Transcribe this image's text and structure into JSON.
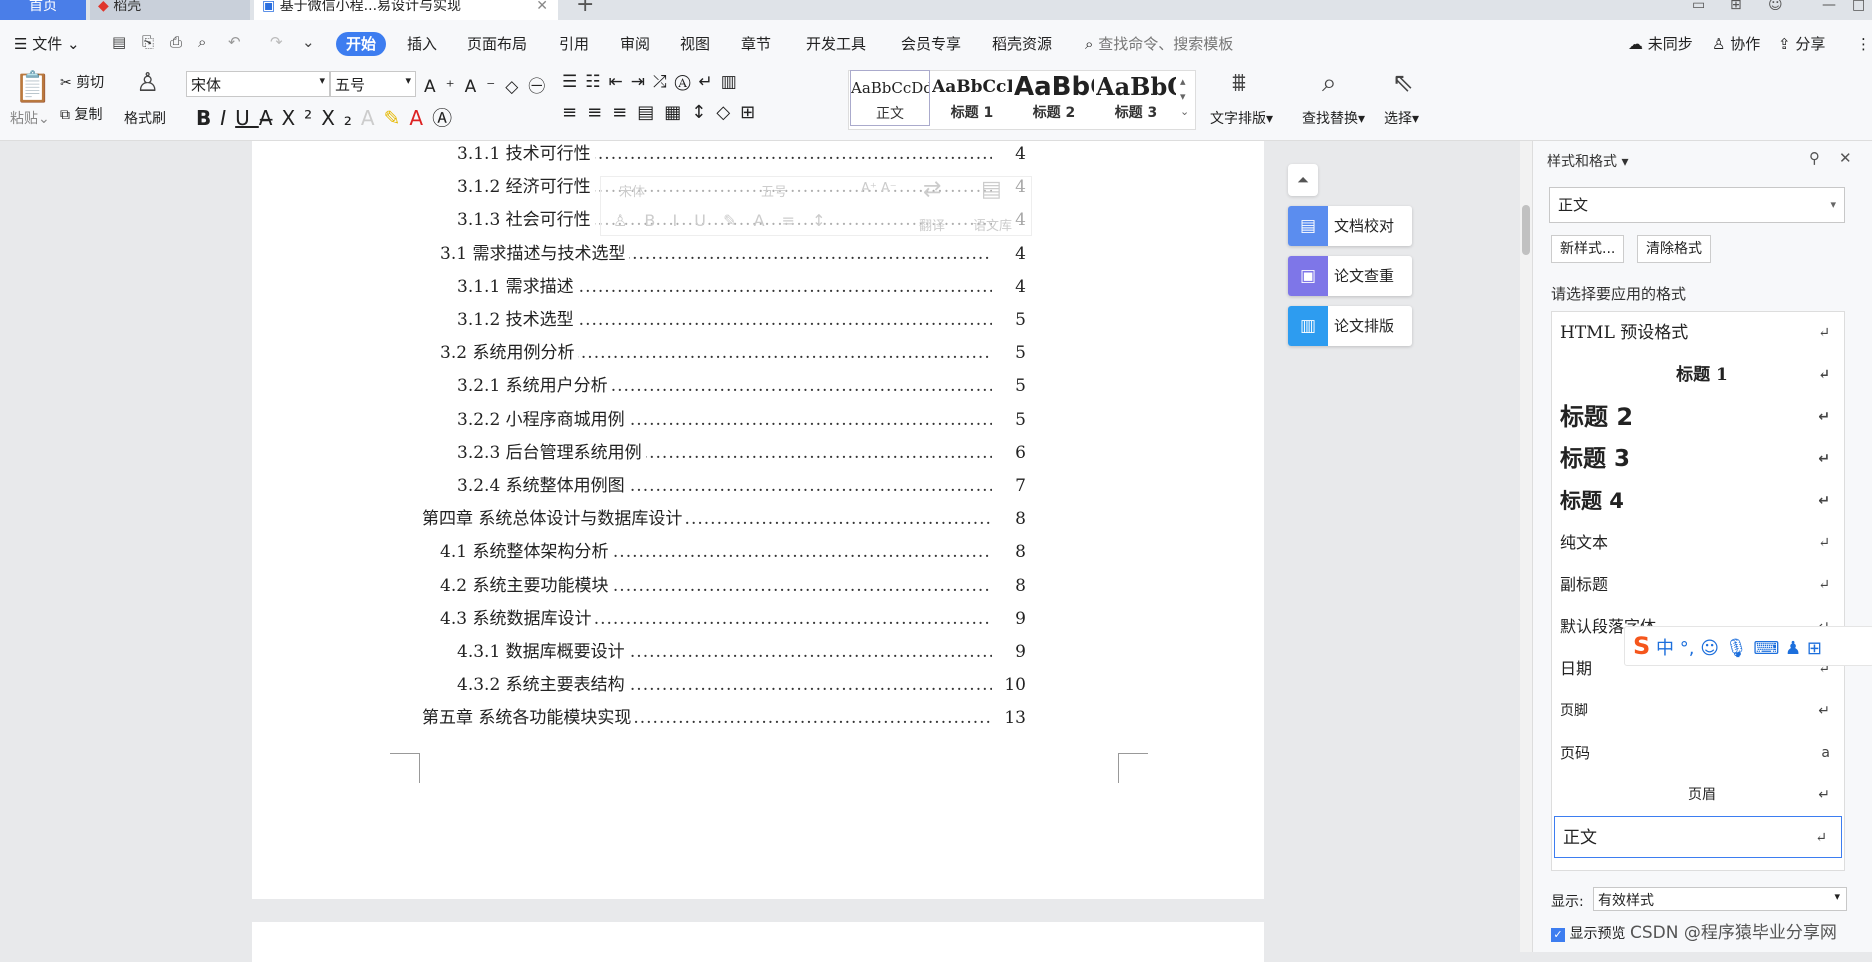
{
  "tabs": {
    "home": "首页",
    "daoke": "稻壳",
    "doc": "基于微信小程...易设计与实现"
  },
  "menu": {
    "file": "文件",
    "items": [
      "开始",
      "插入",
      "页面布局",
      "引用",
      "审阅",
      "视图",
      "章节",
      "开发工具",
      "会员专享",
      "稻壳资源"
    ],
    "search_placeholder": "查找命令、搜索模板",
    "sync": "未同步",
    "collab": "协作",
    "share": "分享"
  },
  "ribbon": {
    "paste": "粘贴",
    "cut": "剪切",
    "copy": "复制",
    "format_painter": "格式刷",
    "font": "宋体",
    "size": "五号",
    "styles": [
      {
        "preview": "AaBbCcDd",
        "name": "正文"
      },
      {
        "preview": "AaBbCcDd",
        "name": "标题 1"
      },
      {
        "preview": "AaBbC",
        "name": "标题 2"
      },
      {
        "preview": "AaBbC",
        "name": "标题 3"
      }
    ],
    "text_layout": "文字排版",
    "find_replace": "查找替换",
    "select": "选择"
  },
  "toc": [
    {
      "text": "3.1.1  技术可行性",
      "page": "4",
      "level": 3
    },
    {
      "text": "3.1.2  经济可行性",
      "page": "4",
      "level": 3
    },
    {
      "text": "3.1.3  社会可行性",
      "page": "4",
      "level": 3
    },
    {
      "text": "3.1  需求描述与技术选型",
      "page": "4",
      "level": 2
    },
    {
      "text": "3.1.1  需求描述",
      "page": "4",
      "level": 3
    },
    {
      "text": "3.1.2  技术选型",
      "page": "5",
      "level": 3
    },
    {
      "text": "3.2  系统用例分析",
      "page": "5",
      "level": 2
    },
    {
      "text": "3.2.1  系统用户分析",
      "page": "5",
      "level": 3
    },
    {
      "text": "3.2.2  小程序商城用例",
      "page": "5",
      "level": 3
    },
    {
      "text": "3.2.3  后台管理系统用例",
      "page": "6",
      "level": 3
    },
    {
      "text": "3.2.4  系统整体用例图",
      "page": "7",
      "level": 3
    },
    {
      "text": "第四章  系统总体设计与数据库设计",
      "page": "8",
      "level": 1
    },
    {
      "text": "4.1  系统整体架构分析",
      "page": "8",
      "level": 2
    },
    {
      "text": "4.2  系统主要功能模块",
      "page": "8",
      "level": 2
    },
    {
      "text": "4.3  系统数据库设计",
      "page": "9",
      "level": 2
    },
    {
      "text": "4.3.1  数据库概要设计",
      "page": "9",
      "level": 3
    },
    {
      "text": "4.3.2  系统主要表结构",
      "page": "10",
      "level": 3
    },
    {
      "text": "第五章  系统各功能模块实现",
      "page": "13",
      "level": 1
    }
  ],
  "float_toolbar": {
    "font": "宋体",
    "size": "五号",
    "translate": "翻译",
    "thesaurus": "语文库"
  },
  "side_tools": [
    "文档校对",
    "论文查重",
    "论文排版"
  ],
  "panel": {
    "title": "样式和格式",
    "current": "正文",
    "new_style": "新样式...",
    "clear_format": "清除格式",
    "apply_label": "请选择要应用的格式",
    "styles": [
      {
        "name": "HTML 预设格式"
      },
      {
        "name": "标题 1"
      },
      {
        "name": "标题 2"
      },
      {
        "name": "标题 3"
      },
      {
        "name": "标题 4"
      },
      {
        "name": "纯文本"
      },
      {
        "name": "副标题"
      },
      {
        "name": "默认段落字体"
      },
      {
        "name": "日期"
      },
      {
        "name": "页脚"
      },
      {
        "name": "页码"
      },
      {
        "name": "页眉"
      },
      {
        "name": "正文"
      }
    ],
    "show_label": "显示:",
    "show_value": "有效样式",
    "preview_label": "显示预览"
  },
  "ime": {
    "lang": "中"
  },
  "watermark": "CSDN @程序猿毕业分享网",
  "colors": {
    "accent": "#3d7df0",
    "side_check": "#5b8def",
    "side_dup": "#7e76e8",
    "side_layout": "#2d9cf0"
  }
}
